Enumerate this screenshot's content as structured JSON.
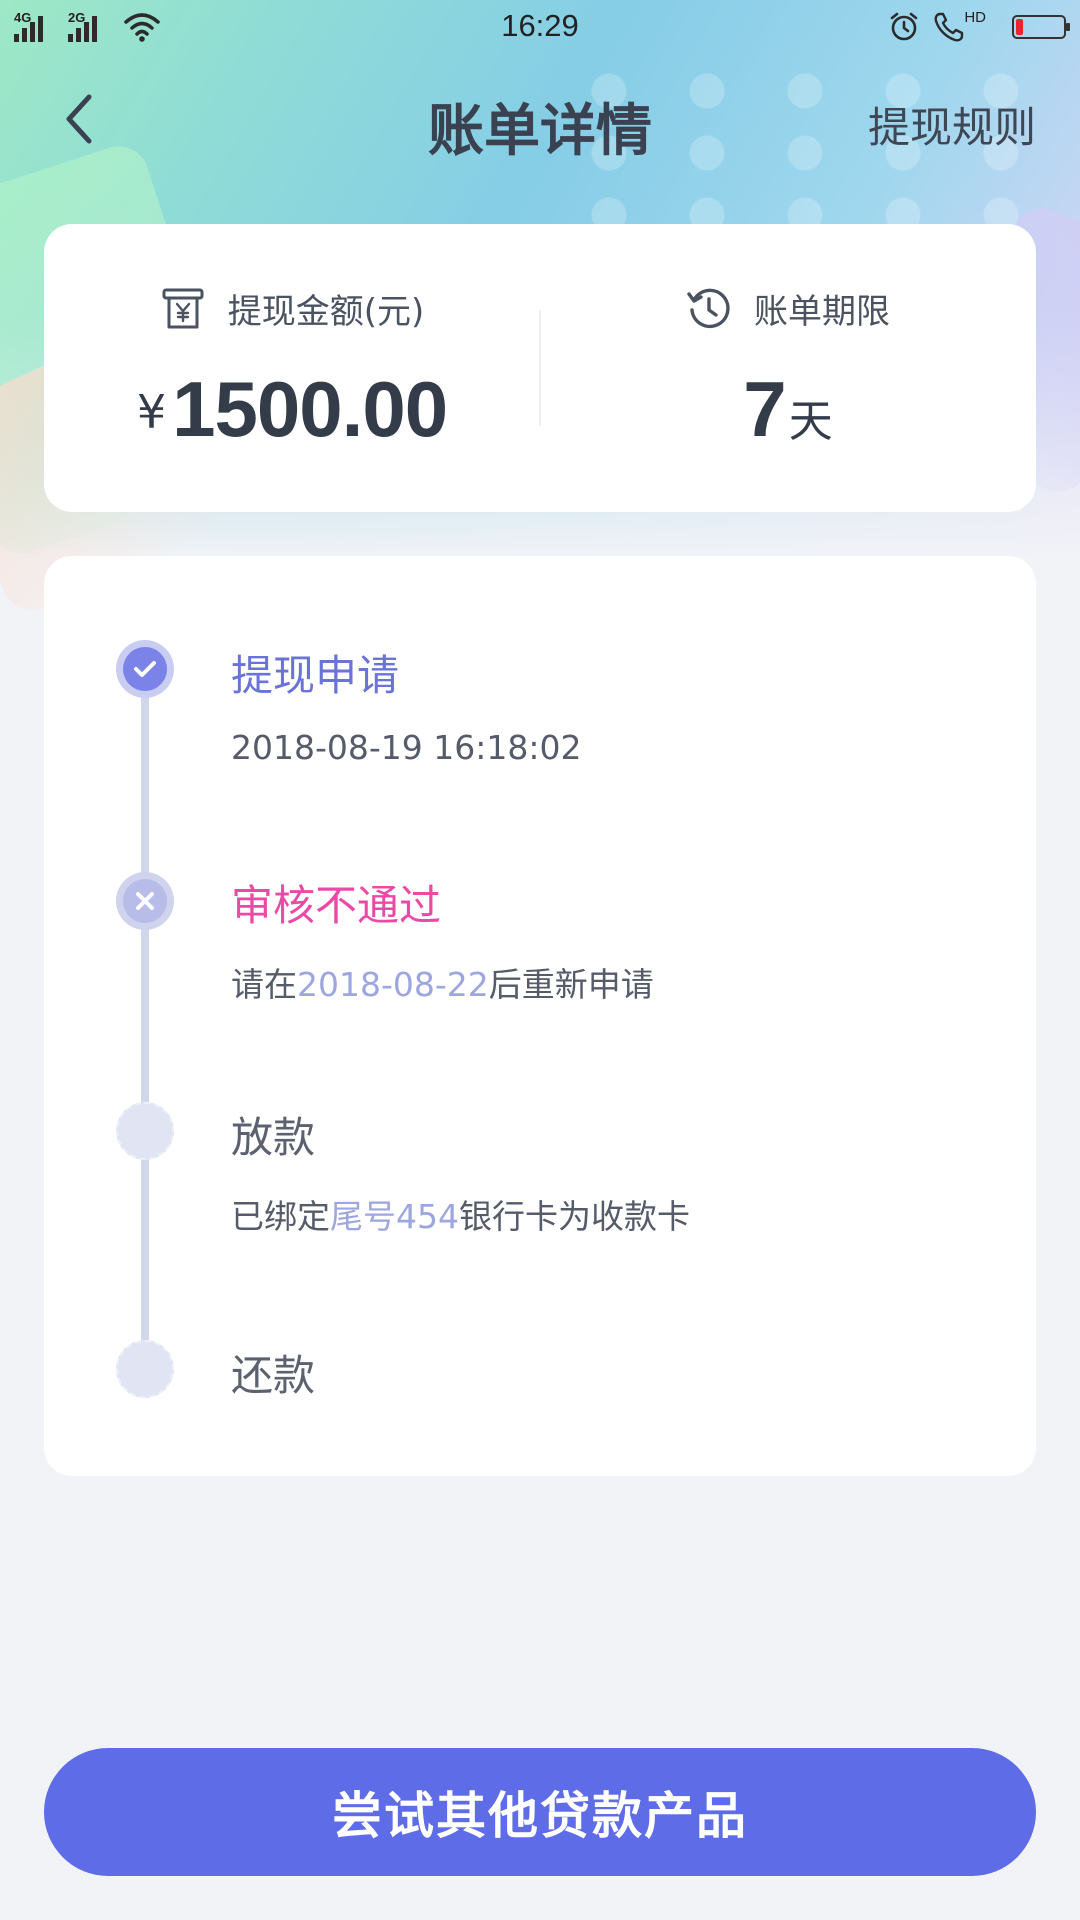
{
  "status_bar": {
    "network_1": "4G",
    "network_2": "2G",
    "time": "16:29",
    "hd_label": "HD",
    "battery_level": 0.15,
    "battery_color": "#e8262b"
  },
  "header": {
    "title": "账单详情",
    "rule_link": "提现规则",
    "back_icon": "chevron-left-icon"
  },
  "summary": {
    "amount_label": "提现金额(元)",
    "amount_icon": "receipt-yen-icon",
    "currency_symbol": "¥",
    "amount_value": "1500.00",
    "term_label": "账单期限",
    "term_icon": "history-clock-icon",
    "term_value": "7",
    "term_unit": "天"
  },
  "timeline": {
    "steps": [
      {
        "title": "提现申请",
        "status": "done",
        "icon": "check-icon",
        "subtitle": "2018-08-19 16:18:02"
      },
      {
        "title": "审核不通过",
        "status": "failed",
        "icon": "close-icon",
        "sub_prefix": "请在",
        "sub_highlight": "2018-08-22",
        "sub_suffix": "后重新申请"
      },
      {
        "title": "放款",
        "status": "pending",
        "sub_prefix": "已绑定",
        "sub_highlight": "尾号454",
        "sub_suffix": "银行卡为收款卡"
      },
      {
        "title": "还款",
        "status": "pending"
      }
    ]
  },
  "cta": {
    "label": "尝试其他贷款产品",
    "color": "#5e6ce8"
  },
  "colors": {
    "accent_blue": "#6a73d9",
    "fail_pink": "#ea4aa5",
    "highlight": "#9ea6df",
    "page_bg": "#f2f3f7"
  }
}
